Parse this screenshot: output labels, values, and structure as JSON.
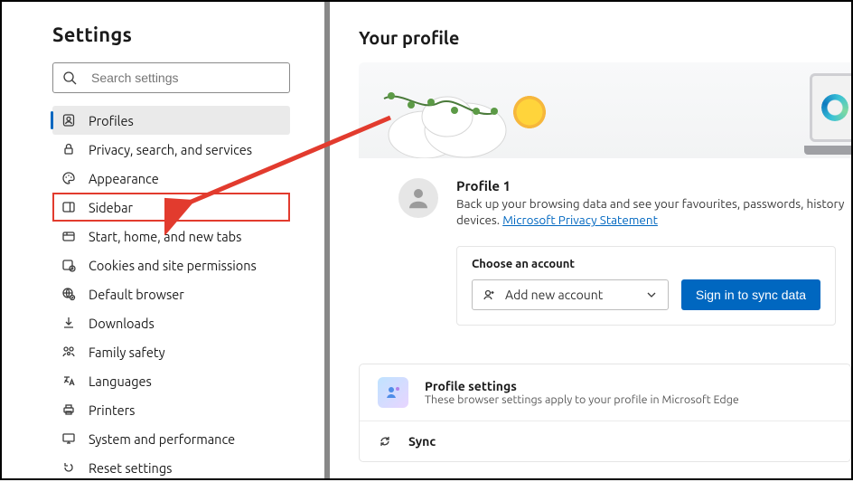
{
  "sidebar": {
    "title": "Settings",
    "search_placeholder": "Search settings",
    "items": [
      {
        "label": "Profiles"
      },
      {
        "label": "Privacy, search, and services"
      },
      {
        "label": "Appearance"
      },
      {
        "label": "Sidebar"
      },
      {
        "label": "Start, home, and new tabs"
      },
      {
        "label": "Cookies and site permissions"
      },
      {
        "label": "Default browser"
      },
      {
        "label": "Downloads"
      },
      {
        "label": "Family safety"
      },
      {
        "label": "Languages"
      },
      {
        "label": "Printers"
      },
      {
        "label": "System and performance"
      },
      {
        "label": "Reset settings"
      }
    ]
  },
  "main": {
    "heading": "Your profile",
    "profile": {
      "name": "Profile 1",
      "desc_prefix": "Back up your browsing data and see your favourites, passwords, history",
      "desc_suffix": "devices. ",
      "privacy_link": "Microsoft Privacy Statement"
    },
    "account": {
      "heading": "Choose an account",
      "dropdown": "Add new account",
      "button": "Sign in to sync data"
    },
    "settings_card": {
      "title": "Profile settings",
      "subtitle": "These browser settings apply to your profile in Microsoft Edge",
      "sync_label": "Sync"
    }
  }
}
